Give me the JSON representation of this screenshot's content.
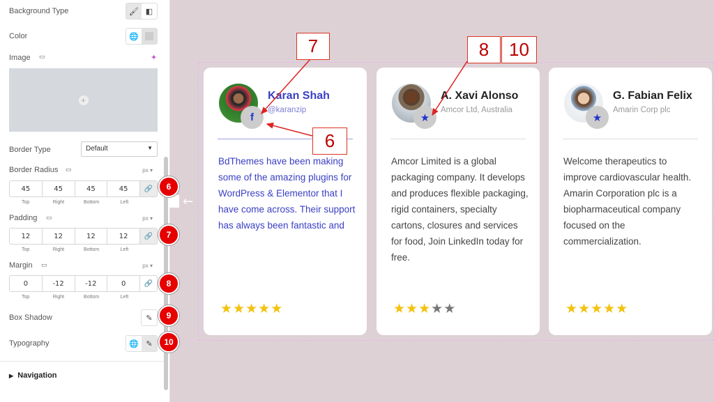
{
  "panel": {
    "background_type": "Background Type",
    "color": "Color",
    "image": "Image",
    "border_type": "Border Type",
    "border_type_value": "Default",
    "border_radius": "Border Radius",
    "border_radius_unit": "px",
    "border_radius_values": [
      "45",
      "45",
      "45",
      "45"
    ],
    "padding": "Padding",
    "padding_unit": "px",
    "padding_values": [
      "12",
      "12",
      "12",
      "12"
    ],
    "margin": "Margin",
    "margin_unit": "px",
    "margin_values": [
      "0",
      "-12",
      "-12",
      "0"
    ],
    "subs": [
      "Top",
      "Right",
      "Bottom",
      "Left"
    ],
    "box_shadow": "Box Shadow",
    "typography": "Typography",
    "navigation": "Navigation"
  },
  "badges": [
    "6",
    "7",
    "8",
    "9",
    "10"
  ],
  "callouts": [
    "7",
    "8",
    "10",
    "6"
  ],
  "cards": [
    {
      "name": "Karan Shah",
      "sub": "@karanzip",
      "icon": "facebook-icon",
      "text": "BdThemes have been making some of the amazing plugins for WordPress & Elementor that I have come across. Their support has always been fantastic and",
      "rating": 5,
      "max": 5
    },
    {
      "name": "A. Xavi Alonso",
      "sub": "Amcor Ltd, Australia",
      "icon": "star-icon",
      "text": "Amcor Limited is a global packaging company. It develops and produces flexible packaging, rigid containers, specialty cartons, closures and services for food, Join LinkedIn today for free.",
      "rating": 3,
      "max": 5
    },
    {
      "name": "G. Fabian Felix",
      "sub": "Amarin Corp plc",
      "icon": "star-icon",
      "text": "Welcome therapeutics to improve cardiovascular health. Amarin Corporation plc is a biopharmaceutical company focused on the commercialization.",
      "rating": 5,
      "max": 5
    }
  ],
  "colors": {
    "accent": "#3a3fc4",
    "badge": "#e60000",
    "star": "#f4c20d",
    "star_empty": "#777777",
    "annotation": "#dd2222"
  }
}
